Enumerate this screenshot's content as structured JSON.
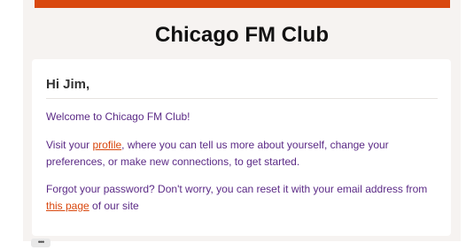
{
  "header": {
    "title": "Chicago FM Club"
  },
  "message": {
    "greeting": "Hi Jim,",
    "welcome": "Welcome to Chicago FM Club!",
    "visit_before": "Visit your ",
    "profile_link": "profile",
    "visit_after": ", where you can tell us more about yourself, change your preferences, or make new connections, to get started.",
    "forgot_before": "Forgot your password? Don't worry, you can reset it with your email address from ",
    "reset_link": "this page",
    "forgot_after": " of our site"
  },
  "footer": {
    "more_label": "•••"
  },
  "colors": {
    "accent": "#d9480f",
    "text_purple": "#5b2a86",
    "background": "#f6f3f1"
  }
}
